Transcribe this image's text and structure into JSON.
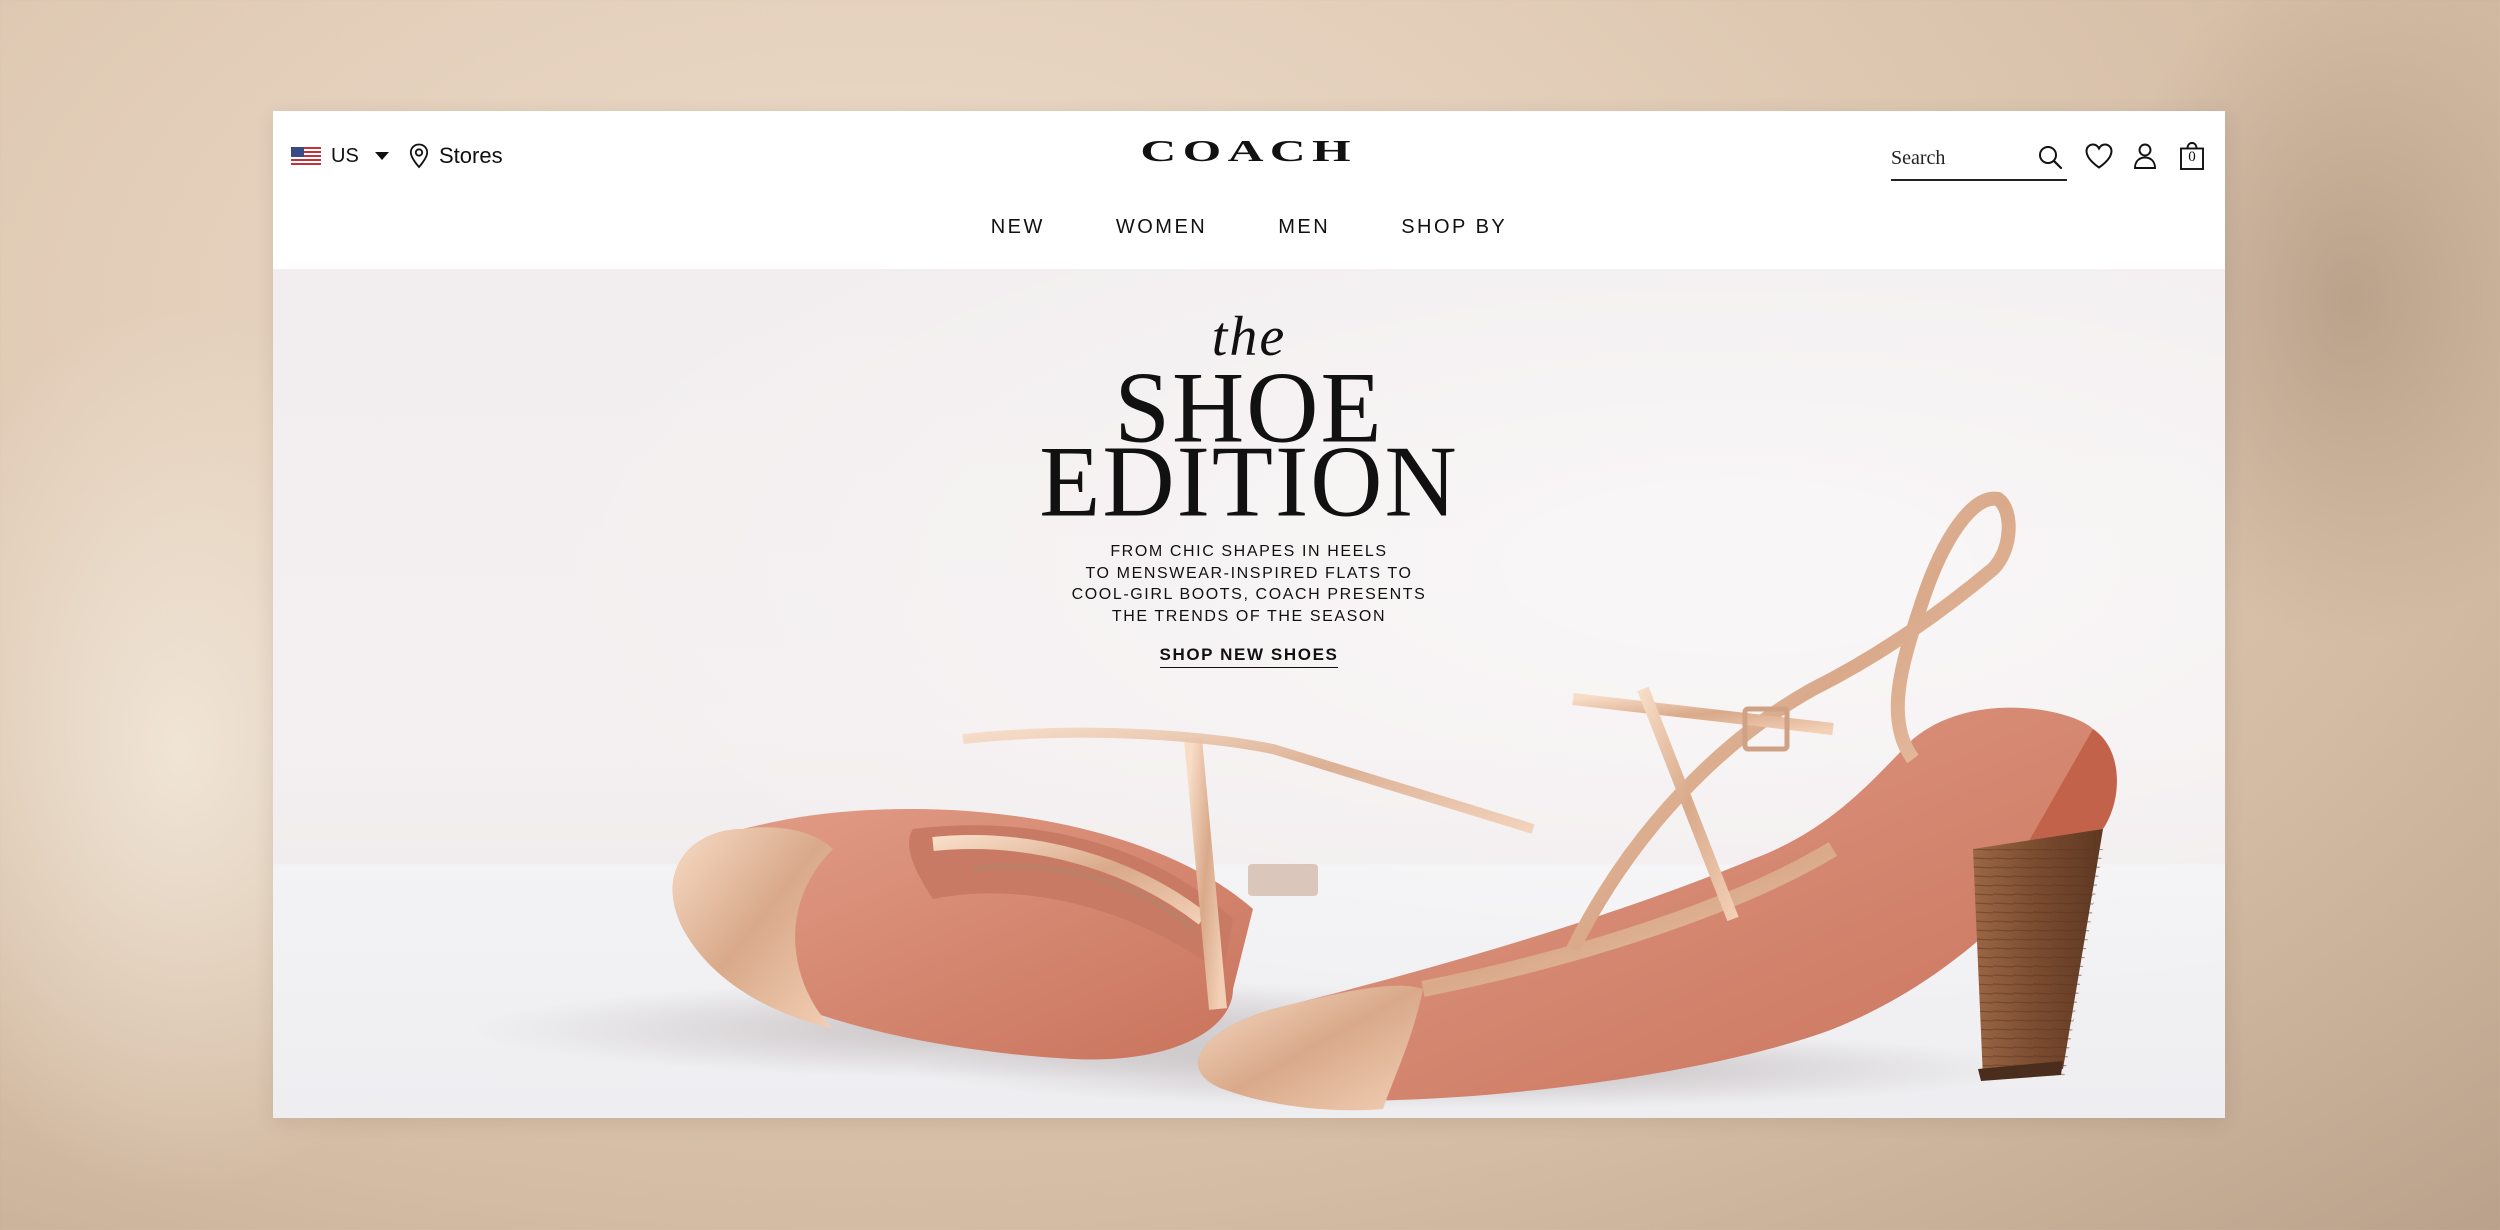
{
  "header": {
    "country": {
      "code": "US",
      "icon": "us-flag-icon"
    },
    "stores_label": "Stores",
    "logo": "COACH",
    "search": {
      "placeholder": "Search",
      "value": ""
    },
    "bag_count": "0"
  },
  "nav": {
    "items": [
      {
        "label": "NEW"
      },
      {
        "label": "WOMEN"
      },
      {
        "label": "MEN"
      },
      {
        "label": "SHOP BY"
      }
    ]
  },
  "hero": {
    "pre_title": "the",
    "title_line1": "SHOE",
    "title_line2": "EDITION",
    "description_lines": [
      "FROM CHIC SHAPES IN HEELS",
      "TO MENSWEAR-INSPIRED FLATS TO",
      "COOL-GIRL BOOTS, COACH PRESENTS",
      "THE TRENDS OF THE SEASON"
    ],
    "cta_label": "SHOP NEW SHOES"
  },
  "colors": {
    "text": "#111111",
    "shoe_leather": "#d98d78",
    "shoe_metallic": "#e8c1a3",
    "heel_wood": "#8a5a3a"
  }
}
